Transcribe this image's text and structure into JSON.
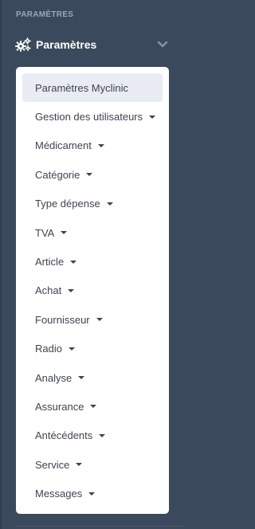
{
  "section": {
    "heading": "PARAMÈTRES"
  },
  "menu": {
    "label": "Paramètres",
    "icon": "gears-icon",
    "expand_icon": "chevron-down-icon",
    "colors": {
      "sidebar_bg": "#3a4a5c",
      "submenu_bg": "#ffffff",
      "active_bg": "#e9ecf3"
    }
  },
  "submenu": {
    "items": [
      {
        "label": "Paramètres Myclinic",
        "active": true,
        "has_dropdown": false
      },
      {
        "label": "Gestion des utilisateurs",
        "has_dropdown": true
      },
      {
        "label": "Médicament",
        "has_dropdown": true
      },
      {
        "label": "Catégorie",
        "has_dropdown": true
      },
      {
        "label": "Type dépense",
        "has_dropdown": true
      },
      {
        "label": "TVA",
        "has_dropdown": true
      },
      {
        "label": "Article",
        "has_dropdown": true
      },
      {
        "label": "Achat",
        "has_dropdown": true
      },
      {
        "label": "Fournisseur",
        "has_dropdown": true
      },
      {
        "label": "Radio",
        "has_dropdown": true
      },
      {
        "label": "Analyse",
        "has_dropdown": true
      },
      {
        "label": "Assurance",
        "has_dropdown": true
      },
      {
        "label": "Antécédents",
        "has_dropdown": true
      },
      {
        "label": "Service",
        "has_dropdown": true
      },
      {
        "label": "Messages",
        "has_dropdown": true
      }
    ]
  }
}
